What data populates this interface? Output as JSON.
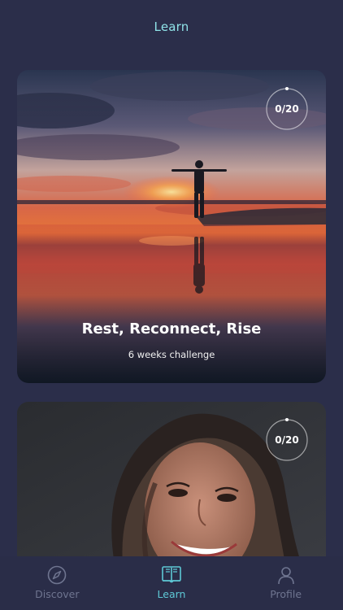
{
  "header": {
    "title": "Learn"
  },
  "cards": [
    {
      "title": "Rest, Reconnect, Rise",
      "subtitle": "6 weeks challenge",
      "progress": "0/20"
    },
    {
      "progress": "0/20"
    }
  ],
  "tabs": [
    {
      "label": "Discover",
      "icon": "compass-icon",
      "active": false
    },
    {
      "label": "Learn",
      "icon": "book-icon",
      "active": true
    },
    {
      "label": "Profile",
      "icon": "person-icon",
      "active": false
    }
  ],
  "colors": {
    "background": "#2b2e4a",
    "accent": "#5ec9d6",
    "header_text": "#8fe3e8",
    "inactive": "#6f7590"
  }
}
